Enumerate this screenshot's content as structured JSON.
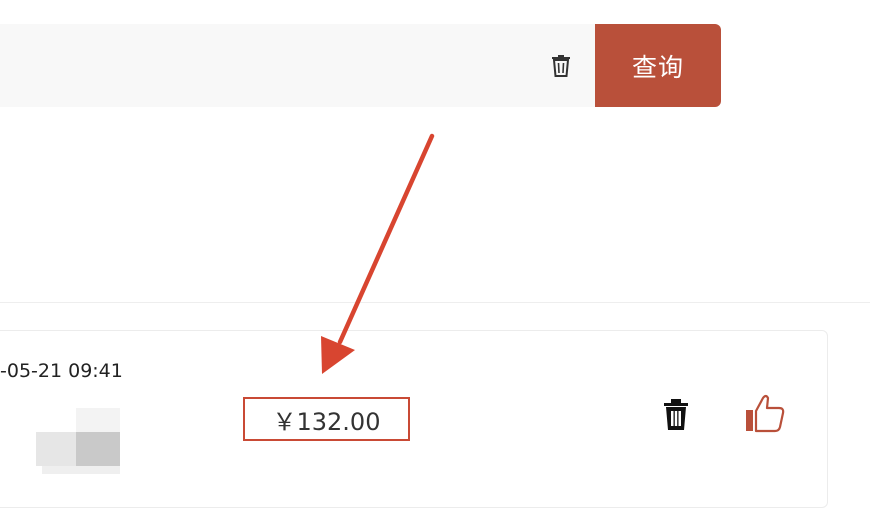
{
  "search": {
    "value": "",
    "placeholder": "",
    "query_label": "查询"
  },
  "record": {
    "time": "-05-21 09:41",
    "price": "￥132.00"
  },
  "icons": {
    "clear": "trash-icon",
    "delete": "trash-icon",
    "like": "thumbs-up-icon"
  },
  "colors": {
    "accent": "#b9503a",
    "highlight": "#c94a35"
  }
}
